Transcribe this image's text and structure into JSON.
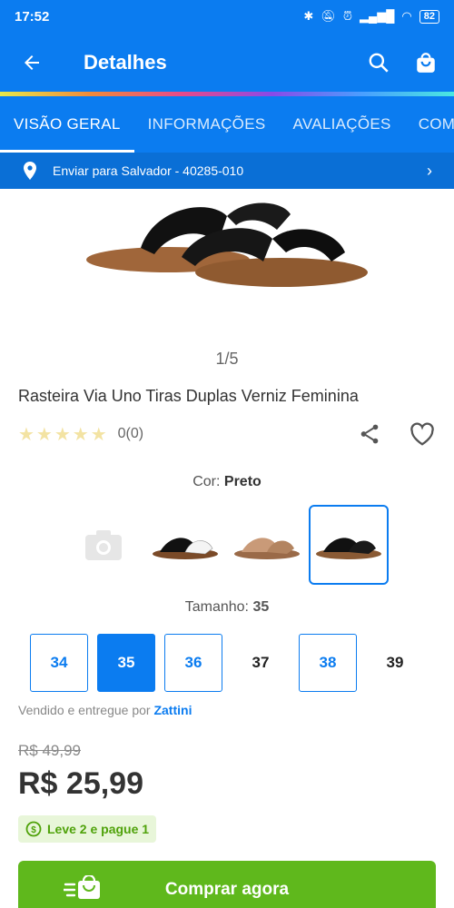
{
  "status": {
    "time": "17:52",
    "battery": "82"
  },
  "appbar": {
    "title": "Detalhes"
  },
  "tabs": [
    {
      "label": "VISÃO GERAL"
    },
    {
      "label": "INFORMAÇÕES"
    },
    {
      "label": "AVALIAÇÕES"
    },
    {
      "label": "COMP"
    }
  ],
  "shipping": {
    "text": "Enviar para Salvador - 40285-010"
  },
  "gallery": {
    "counter": "1/5"
  },
  "product": {
    "name": "Rasteira Via Uno Tiras Duplas Verniz Feminina",
    "stars": "★★★★★",
    "rating_count": "0(0)"
  },
  "color": {
    "label": "Cor:",
    "value": "Preto"
  },
  "size": {
    "label": "Tamanho:",
    "value": "35",
    "options": [
      "34",
      "35",
      "36",
      "37",
      "38",
      "39"
    ]
  },
  "seller": {
    "prefix": "Vendido e entregue por",
    "name": "Zattini"
  },
  "price": {
    "old": "R$ 49,99",
    "current": "R$ 25,99"
  },
  "promo": {
    "label": "Leve 2 e pague 1"
  },
  "buy": {
    "label": "Comprar agora"
  }
}
